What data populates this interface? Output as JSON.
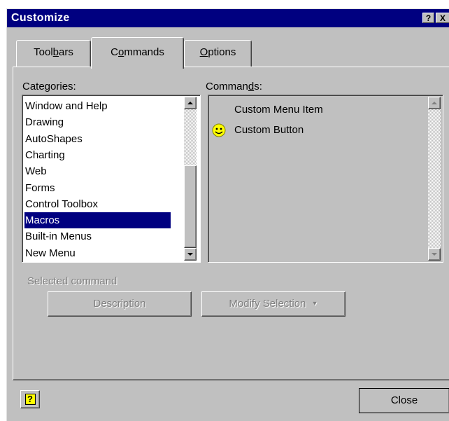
{
  "window": {
    "title": "Customize",
    "help_glyph": "?",
    "close_glyph": "X"
  },
  "tabs": [
    {
      "label": "Toolbars",
      "underline_index": 5
    },
    {
      "label": "Commands",
      "underline_index": 1
    },
    {
      "label": "Options",
      "underline_index": 0
    }
  ],
  "categories": {
    "label": "Categories:",
    "items": [
      "Window and Help",
      "Drawing",
      "AutoShapes",
      "Charting",
      "Web",
      "Forms",
      "Control Toolbox",
      "Macros",
      "Built-in Menus",
      "New Menu"
    ],
    "selected": "Macros"
  },
  "commands": {
    "label": "Commands:",
    "items": [
      {
        "label": "Custom Menu Item",
        "icon": "none"
      },
      {
        "label": "Custom Button",
        "icon": "smiley-icon"
      }
    ]
  },
  "selected_command": {
    "label": "Selected command",
    "description_button": "Description",
    "modify_button": "Modify Selection"
  },
  "footer": {
    "help_button": "?",
    "close_button": "Close"
  },
  "colors": {
    "face": "#c0c0c0",
    "titlebar": "#000080",
    "selection": "#000080",
    "smiley": "#ffff00"
  }
}
